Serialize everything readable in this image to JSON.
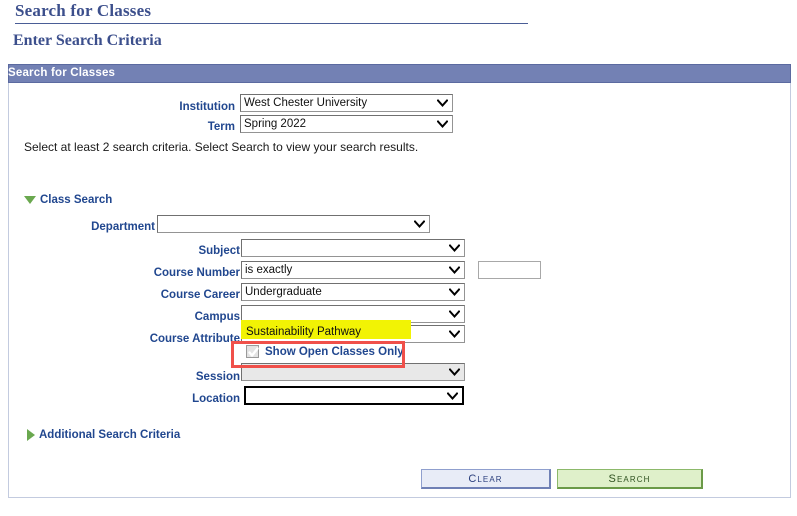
{
  "page": {
    "title": "Search for Classes",
    "section_heading": "Enter Search Criteria"
  },
  "group": {
    "header": "Search for Classes",
    "instruction": "Select at least 2 search criteria. Select Search to view your search results."
  },
  "top_fields": [
    {
      "label": "Institution",
      "value": "West Chester University",
      "name": "institution-select"
    },
    {
      "label": "Term",
      "value": "Spring 2022",
      "name": "term-select"
    }
  ],
  "class_search": {
    "toggle_label": "Class Search",
    "toggle_icon": "triangle-down-icon",
    "expanded": true,
    "fields": [
      {
        "label": "Department",
        "value": "",
        "name": "department-select"
      },
      {
        "label": "Subject",
        "value": "",
        "name": "subject-select"
      },
      {
        "label": "Course Number",
        "value": "is exactly",
        "name": "course-number-operator-select"
      },
      {
        "label": "Course Career",
        "value": "Undergraduate",
        "name": "course-career-select"
      },
      {
        "label": "Campus",
        "value": "",
        "name": "campus-select"
      },
      {
        "label": "Course Attribute",
        "value": "Sustainability Pathway",
        "name": "course-attribute-select"
      },
      {
        "label": "Session",
        "value": "",
        "name": "session-select"
      },
      {
        "label": "Location",
        "value": "",
        "name": "location-select"
      }
    ],
    "course_number_input": {
      "value": "",
      "name": "course-number-input"
    },
    "open_classes_checkbox": {
      "label": "Show Open Classes Only",
      "checked": true,
      "name": "show-open-classes-only-checkbox"
    }
  },
  "additional_criteria": {
    "toggle_label": "Additional Search Criteria",
    "toggle_icon": "triangle-right-icon",
    "expanded": false
  },
  "buttons": {
    "clear": "Clear",
    "search": "Search"
  },
  "annotations": {
    "highlight_color": "#f2f304",
    "highlight_target": "Course Attribute value",
    "callout_color": "#f0504a",
    "callout_target": "Show Open Classes Only checkbox"
  },
  "colors": {
    "header_bar": "#7381b4",
    "label_blue": "#21478f",
    "title_blue": "#3c4f8c",
    "search_button": "#dff0ca",
    "clear_button": "#e8ecf7",
    "triangle_green": "#6aa84f"
  }
}
